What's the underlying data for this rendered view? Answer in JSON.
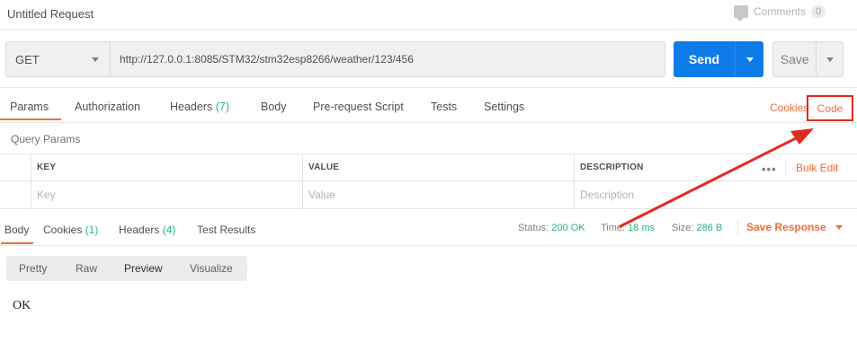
{
  "request": {
    "title": "Untitled Request",
    "comments_label": "Comments",
    "comments_count": "0",
    "method": "GET",
    "url": "http://127.0.0.1:8085/STM32/stm32esp8266/weather/123/456",
    "send_label": "Send",
    "save_label": "Save"
  },
  "request_tabs": {
    "params": "Params",
    "authorization": "Authorization",
    "headers": "Headers",
    "headers_count": "(7)",
    "body": "Body",
    "prerequest": "Pre-request Script",
    "tests": "Tests",
    "settings": "Settings",
    "cookies": "Cookies",
    "code": "Code"
  },
  "query_params": {
    "title": "Query Params",
    "columns": [
      "KEY",
      "VALUE",
      "DESCRIPTION"
    ],
    "placeholders": [
      "Key",
      "Value",
      "Description"
    ],
    "more": "•••",
    "bulk_edit": "Bulk Edit"
  },
  "response": {
    "tabs": {
      "body": "Body",
      "cookies": "Cookies",
      "cookies_count": "(1)",
      "headers": "Headers",
      "headers_count": "(4)",
      "test_results": "Test Results"
    },
    "status_label": "Status:",
    "status_value": "200 OK",
    "time_label": "Time:",
    "time_value": "18 ms",
    "size_label": "Size:",
    "size_value": "286 B",
    "save_response": "Save Response",
    "view_tabs": [
      "Pretty",
      "Raw",
      "Preview",
      "Visualize"
    ],
    "body_text": "OK"
  },
  "colors": {
    "accent": "#f26b3a",
    "send_blue": "#0e7ce8",
    "count_green": "#26b47f",
    "annotation_red": "#e12a1e"
  }
}
